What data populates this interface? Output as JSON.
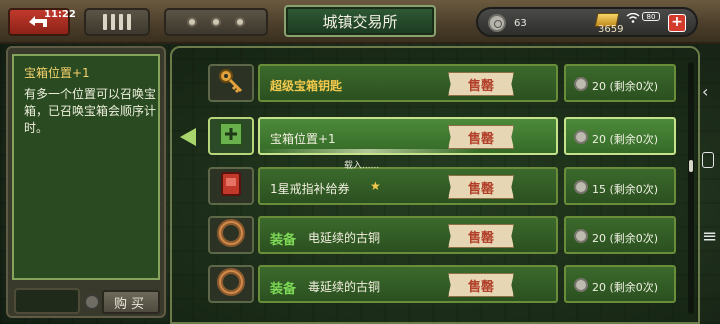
{
  "status": {
    "time": "11:22",
    "battery": "80"
  },
  "header": {
    "title": "城镇交易所"
  },
  "currency": {
    "coins": "63",
    "gold": "3659"
  },
  "info": {
    "title": "宝箱位置+1",
    "description": "有多一个位置可以召唤宝箱，已召唤宝箱会顺序计时。",
    "buy_label": "购买"
  },
  "loading_text": "载入......",
  "items": [
    {
      "name": "超级宝箱钥匙",
      "tag": "",
      "highlight": "gold",
      "star": false,
      "soldout": "售罄",
      "price": "20 (剩余0次)",
      "icon": "key-icon",
      "selected": false
    },
    {
      "name": "宝箱位置+1",
      "tag": "",
      "highlight": "",
      "star": false,
      "soldout": "售罄",
      "price": "20 (剩余0次)",
      "icon": "chest-slot-icon",
      "selected": true
    },
    {
      "name": "1星戒指补给券",
      "tag": "",
      "highlight": "",
      "star": true,
      "soldout": "售罄",
      "price": "15 (剩余0次)",
      "icon": "coupon-icon",
      "selected": false
    },
    {
      "name": "电延续的古铜",
      "tag": "装备",
      "highlight": "",
      "star": false,
      "soldout": "售罄",
      "price": "20 (剩余0次)",
      "icon": "ring-icon",
      "selected": false
    },
    {
      "name": "毒延续的古铜",
      "tag": "装备",
      "highlight": "",
      "star": false,
      "soldout": "售罄",
      "price": "20 (剩余0次)",
      "icon": "ring-icon",
      "selected": false
    }
  ],
  "colors": {
    "accent_green": "#7ed957",
    "gold_text": "#f2c94c",
    "soldout_red": "#b2402b"
  }
}
